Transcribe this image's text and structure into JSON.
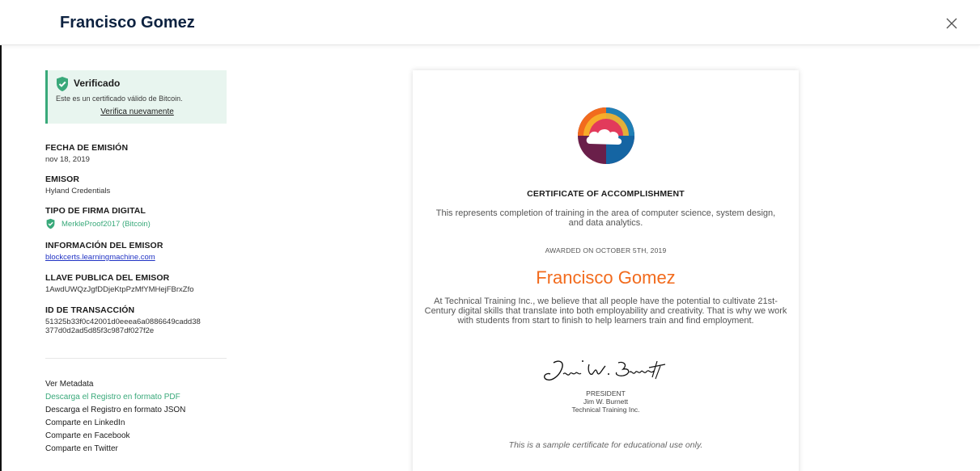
{
  "header": {
    "title": "Francisco Gomez"
  },
  "verification": {
    "title": "Verificado",
    "subtitle": "Este es un certificado válido de Bitcoin.",
    "link": "Verifica nuevamente",
    "color": "#39a97a"
  },
  "fields": {
    "issue_date": {
      "label": "FECHA DE EMISIÓN",
      "value": "nov 18, 2019"
    },
    "issuer": {
      "label": "EMISOR",
      "value": "Hyland Credentials"
    },
    "signature_type": {
      "label": "TIPO DE FIRMA DIGITAL",
      "value": "MerkleProof2017 (Bitcoin)"
    },
    "issuer_info": {
      "label": "INFORMACIÓN DEL EMISOR",
      "value": "blockcerts.learningmachine.com"
    },
    "issuer_key": {
      "label": "LLAVE PUBLICA DEL EMISOR",
      "value": "1AwdUWQzJgfDDjeKtpPzMfYMHejFBrxZfo"
    },
    "transaction_id": {
      "label": "ID DE TRANSACCIÓN",
      "value_line1": "51325b33f0c42001d0eeea6a0886649cadd38",
      "value_line2": "377d0d2ad5d85f3c987df027f2e"
    }
  },
  "actions": [
    "Ver Metadata",
    "Descarga el Registro en formato PDF",
    "Descarga el Registro en formato JSON",
    "Comparte en LinkedIn",
    "Comparte en Facebook",
    "Comparte en Twitter"
  ],
  "certificate": {
    "heading": "CERTIFICATE OF ACCOMPLISHMENT",
    "description": "This represents completion of training in the area of computer science, system design, and data analytics.",
    "awarded": "AWARDED ON OCTOBER 5TH, 2019",
    "recipient": "Francisco Gomez",
    "body": "At Technical Training Inc., we believe that all people have the potential to cultivate 21st-Century digital skills that translate into both employability and creativity. That is why we work with students from start to finish to help learners train and find employment.",
    "signature": "Jim W. Burnett",
    "signer_role": "PRESIDENT",
    "signer_name": "Jim W. Burnett",
    "signer_org": "Technical Training Inc.",
    "note": "This is a sample certificate for educational use only.",
    "name_color": "#f26b1d"
  }
}
